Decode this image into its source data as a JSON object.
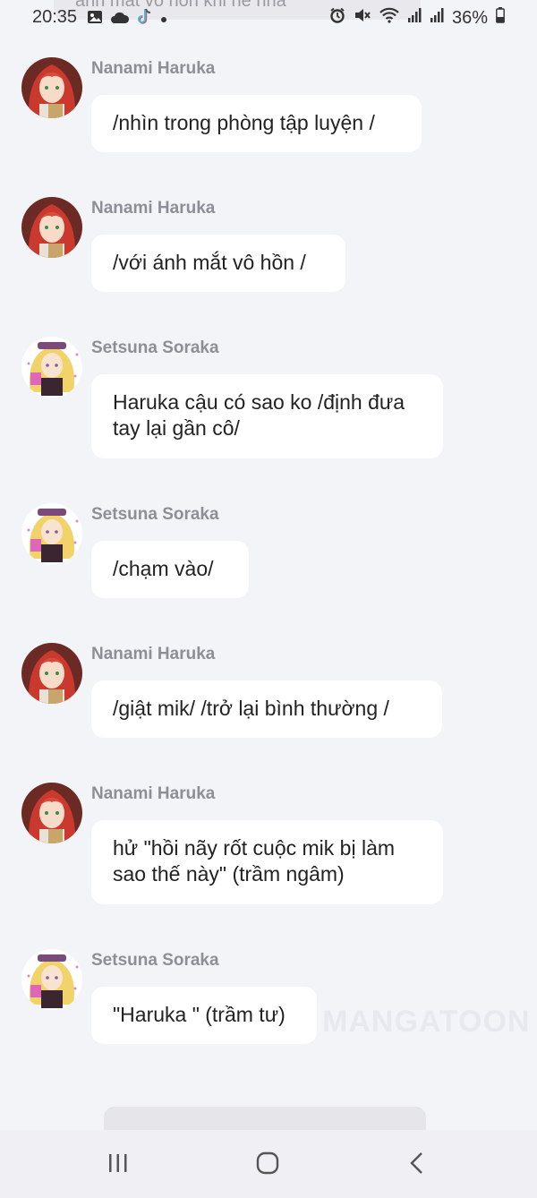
{
  "status_bar": {
    "time": "20:35",
    "battery": "36%",
    "ghost_text": "ánh mắt vô hồn khi nè nha",
    "left_icons": [
      "image-icon",
      "cloud-icon",
      "tiktok-icon",
      "dot-icon"
    ],
    "right_icons": [
      "alarm-icon",
      "mute-icon",
      "wifi-icon",
      "signal-icon",
      "signal-icon",
      "battery-icon"
    ]
  },
  "messages": [
    {
      "sender": "Nanami Haruka",
      "text": "/nhìn trong phòng tập luyện /",
      "avatar": "red-hair-avatar"
    },
    {
      "sender": "Nanami Haruka",
      "text": "/với ánh mắt vô hồn /",
      "avatar": "red-hair-avatar"
    },
    {
      "sender": "Setsuna Soraka",
      "text": "Haruka cậu có sao ko /định đưa tay lại gần cô/",
      "avatar": "blonde-hair-avatar"
    },
    {
      "sender": "Setsuna Soraka",
      "text": "/chạm vào/",
      "avatar": "blonde-hair-avatar"
    },
    {
      "sender": "Nanami Haruka",
      "text": "/giật mik/ /trở lại bình thường /",
      "avatar": "red-hair-avatar"
    },
    {
      "sender": "Nanami Haruka",
      "text": "hử \"hồi nãy rốt cuộc mik bị làm sao thế này\" (trầm ngâm)",
      "avatar": "red-hair-avatar"
    },
    {
      "sender": "Setsuna Soraka",
      "text": "\"Haruka \" (trầm tư)",
      "avatar": "blonde-hair-avatar"
    }
  ],
  "watermark": "MANGATOON",
  "navbar": {
    "buttons": [
      "recent-apps-icon",
      "home-icon",
      "back-icon"
    ]
  }
}
